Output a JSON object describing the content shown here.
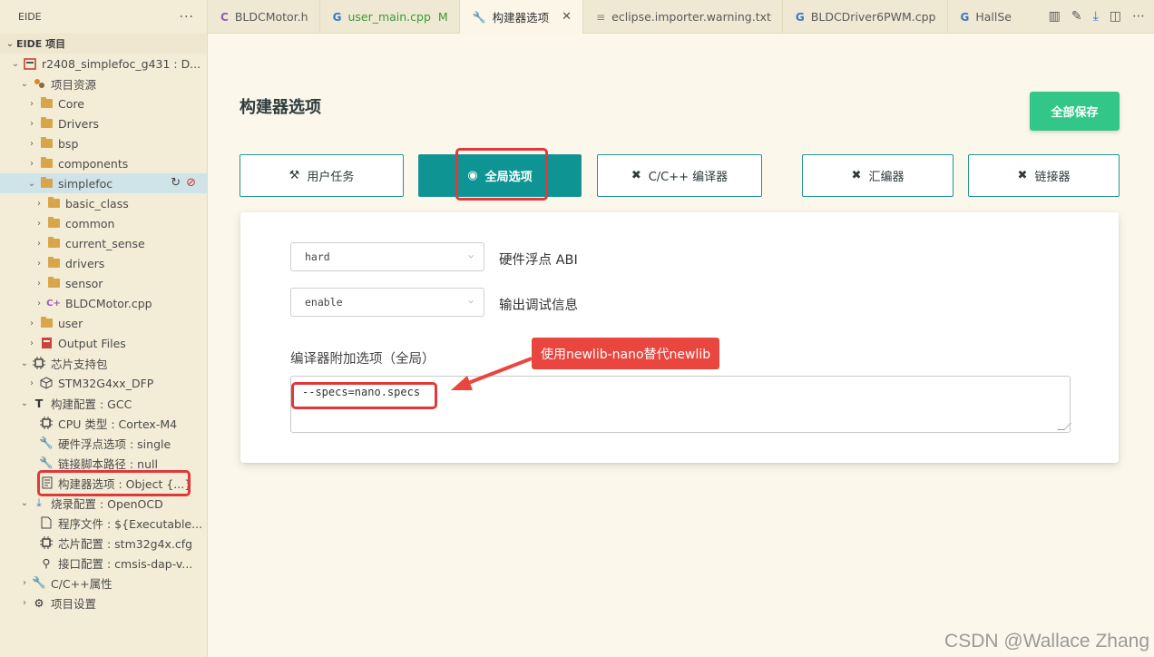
{
  "sidebar": {
    "title": "EIDE",
    "more": "···",
    "section": "EIDE 项目",
    "rows": [
      {
        "label": "r2408_simplefoc_g431 : D..."
      },
      {
        "label": "项目资源"
      },
      {
        "label": "Core"
      },
      {
        "label": "Drivers"
      },
      {
        "label": "bsp"
      },
      {
        "label": "components"
      },
      {
        "label": "simplefoc"
      },
      {
        "label": "basic_class"
      },
      {
        "label": "common"
      },
      {
        "label": "current_sense"
      },
      {
        "label": "drivers"
      },
      {
        "label": "sensor"
      },
      {
        "label": "BLDCMotor.cpp"
      },
      {
        "label": "user"
      },
      {
        "label": "Output Files"
      },
      {
        "label": "芯片支持包"
      },
      {
        "label": "STM32G4xx_DFP"
      },
      {
        "label": "构建配置 : GCC"
      },
      {
        "label": "CPU 类型 : Cortex-M4"
      },
      {
        "label": "硬件浮点选项 : single"
      },
      {
        "label": "链接脚本路径 : null"
      },
      {
        "label": "构建器选项 : Object {...}"
      },
      {
        "label": "烧录配置 : OpenOCD"
      },
      {
        "label": "程序文件 : ${Executable..."
      },
      {
        "label": "芯片配置 : stm32g4x.cfg"
      },
      {
        "label": "接口配置 : cmsis-dap-v..."
      },
      {
        "label": "C/C++属性"
      },
      {
        "label": "项目设置"
      }
    ]
  },
  "tabs": [
    {
      "label": "BLDCMotor.h"
    },
    {
      "label": "user_main.cpp",
      "status": "M"
    },
    {
      "label": "构建器选项",
      "close": "✕"
    },
    {
      "label": "eclipse.importer.warning.txt"
    },
    {
      "label": "BLDCDriver6PWM.cpp"
    },
    {
      "label": "HallSe"
    }
  ],
  "page": {
    "title": "构建器选项",
    "save_all": "全部保存",
    "option_tabs": [
      {
        "label": "用户任务"
      },
      {
        "label": "全局选项"
      },
      {
        "label": "C/C++ 编译器"
      },
      {
        "label": "汇编器"
      },
      {
        "label": "链接器"
      }
    ],
    "float_abi": {
      "value": "hard",
      "label": "硬件浮点 ABI"
    },
    "debug_info": {
      "value": "enable",
      "label": "输出调试信息"
    },
    "global_options_label": "编译器附加选项（全局）",
    "global_options_value": "--specs=nano.specs",
    "annotation": "使用newlib-nano替代newlib"
  },
  "watermark": "CSDN @Wallace Zhang",
  "colors": {
    "accent": "#0f9494",
    "save": "#33c689",
    "highlight": "#e0383b"
  }
}
